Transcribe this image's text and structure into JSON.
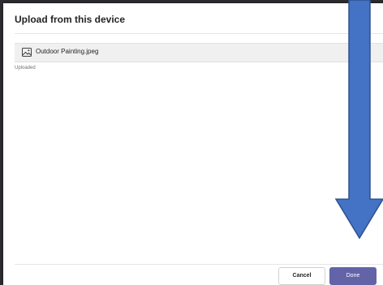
{
  "dialog": {
    "title": "Upload from this device",
    "file": {
      "icon": "image-file-icon",
      "name": "Outdoor Painting.jpeg",
      "status": "Uploaded"
    },
    "buttons": {
      "cancel_label": "Cancel",
      "done_label": "Done"
    }
  },
  "annotation": {
    "icon": "down-arrow-icon",
    "color": "#4472c4"
  },
  "colors": {
    "accent": "#6264a7",
    "arrow_fill": "#4472c4",
    "arrow_stroke": "#2f528f"
  }
}
